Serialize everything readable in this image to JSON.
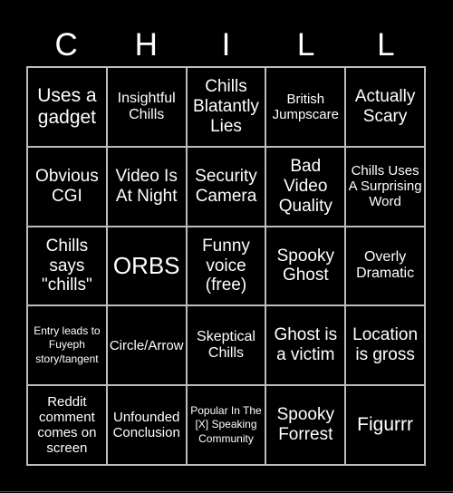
{
  "title_letters": [
    "C",
    "H",
    "I",
    "L",
    "L"
  ],
  "cells": [
    "Uses a gadget",
    "Insightful Chills",
    "Chills Blatantly Lies",
    "British Jumpscare",
    "Actually Scary",
    "Obvious CGI",
    "Video Is At Night",
    "Security Camera",
    "Bad Video Quality",
    "Chills Uses A Surprising Word",
    "Chills says \"chills\"",
    "ORBS",
    "Funny voice (free)",
    "Spooky Ghost",
    "Overly Dramatic",
    "Entry leads to Fuyeph story/tangent",
    "Circle/Arrow",
    "Skeptical Chills",
    "Ghost is a victim",
    "Location is gross",
    "Reddit comment comes on screen",
    "Unfounded Conclusion",
    "Popular In The [X] Speaking Community",
    "Spooky Forrest",
    "Figurrr"
  ],
  "colors": {
    "background": "#000000",
    "text": "#ffffff",
    "grid_line": "#bdbdbd"
  }
}
